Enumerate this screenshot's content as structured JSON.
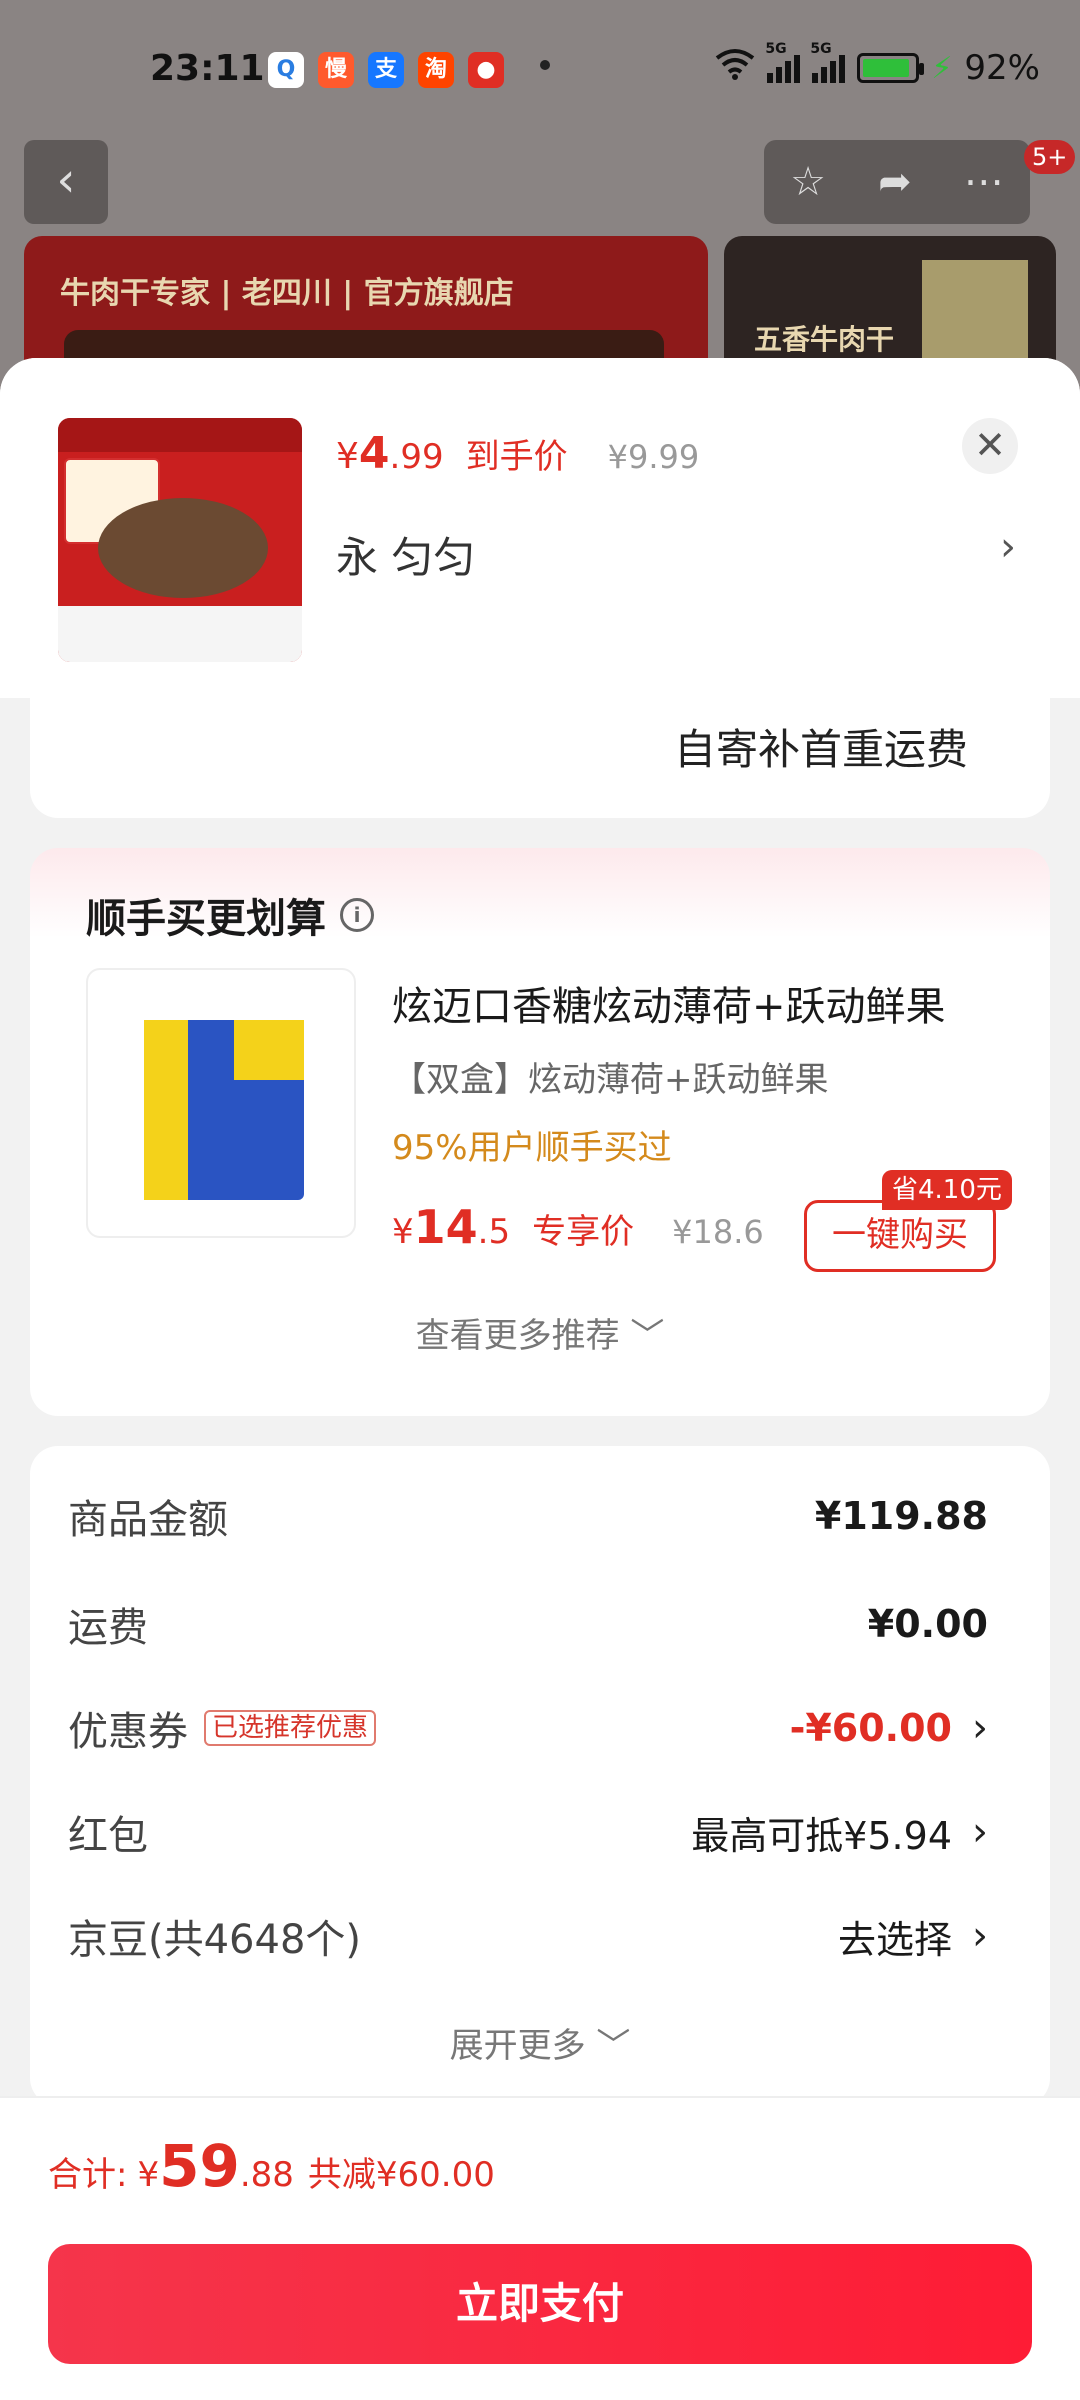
{
  "status_bar": {
    "time": "23:11",
    "battery": "92%",
    "battery_level": 0.92,
    "icons": [
      "search-app-icon",
      "man-app-icon",
      "alipay-icon",
      "taobao-icon",
      "pdd-icon"
    ]
  },
  "background": {
    "badge": "5+",
    "banner_left_text": "牛肉干专家 | 老四川 | 官方旗舰店",
    "banner_right_text": "五香牛肉干"
  },
  "sheet_header": {
    "price_currency": "¥",
    "price_int": "4",
    "price_dec": ".99",
    "price_tag": "到手价",
    "orig_price": "¥9.99",
    "spec": "永 匀匀",
    "close_icon": "close-icon"
  },
  "shipping": {
    "text": "自寄补首重运费"
  },
  "recommend": {
    "title": "顺手买更划算",
    "product_name": "炫迈口香糖炫动薄荷+跃动鲜果",
    "product_sub": "【双盒】炫动薄荷+跃动鲜果",
    "bought_text": "95%用户顺手买过",
    "price_currency": "¥",
    "price_int": "14",
    "price_dec": ".5",
    "price_tag": "专享价",
    "orig_price": "¥18.6",
    "save_badge": "省4.10元",
    "buy_button": "一键购买",
    "more": "查看更多推荐"
  },
  "summary": {
    "rows": [
      {
        "label": "商品金额",
        "value": "¥119.88"
      },
      {
        "label": "运费",
        "value": "¥0.00"
      },
      {
        "label": "优惠券",
        "badge": "已选推荐优惠",
        "value": "-¥60.00"
      },
      {
        "label": "红包",
        "value": "最高可抵¥5.94"
      },
      {
        "label": "京豆(共4648个)",
        "value": "去选择"
      }
    ],
    "expand": "展开更多"
  },
  "footer": {
    "total_label": "合计:",
    "total_currency": "¥",
    "total_int": "59",
    "total_dec": ".88",
    "saved": "共减¥60.00",
    "pay_button": "立即支付"
  },
  "colors": {
    "accent": "#e02e24",
    "pay_gradient_start": "#f5354b",
    "pay_gradient_end": "#fe1c35"
  }
}
